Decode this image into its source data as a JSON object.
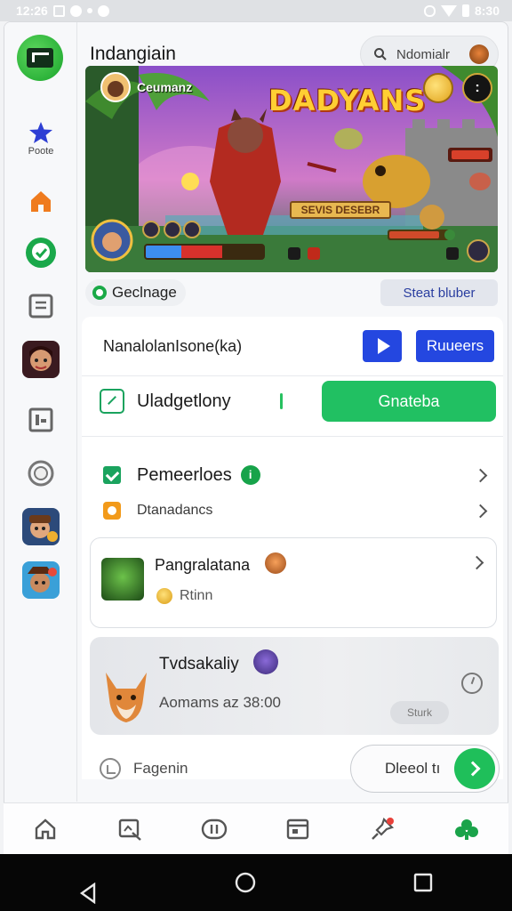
{
  "status_bar": {
    "time_left": "12:26",
    "time_right": "8:30"
  },
  "header": {
    "title": "Indangiain",
    "search_placeholder": "Ndomialr"
  },
  "rail": {
    "items": [
      {
        "label": "Poote",
        "icon": "star-icon"
      }
    ]
  },
  "banner": {
    "title": "DADYANS",
    "username": "Ceumanz",
    "sign_text": "SEVIS DESEBR",
    "health_fraction_blue": 0.3,
    "health_fraction_red": 0.65
  },
  "chips": {
    "left": "Geclnage",
    "right": "Steat bluber"
  },
  "row_stream": {
    "label": "NanalolanIsone(ka)",
    "button": "Ruueers"
  },
  "row_edit": {
    "label": "Uladgetlony",
    "button": "Gnateba"
  },
  "row_perm": {
    "label": "Pemeerloes",
    "badge": "i"
  },
  "row_sub": {
    "label": "Dtanadancs"
  },
  "card_one": {
    "title": "Pangralatana",
    "subtitle": "Rtinn"
  },
  "card_two": {
    "title": "Tvdsakaliy",
    "subtitle": "Aomams az 38:00",
    "pill": "Sturk"
  },
  "footer_row": {
    "label": "Fagenin",
    "button": "Dleeol tı"
  },
  "colors": {
    "accent_green": "#21c062",
    "accent_blue": "#2447e0"
  }
}
